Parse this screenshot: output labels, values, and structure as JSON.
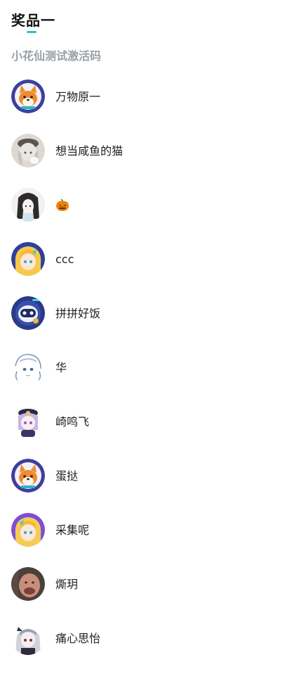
{
  "header": {
    "title": "奖品一",
    "subtitle": "小花仙测试激活码"
  },
  "winners": [
    {
      "name": "万物原一",
      "avatar": "shiba-dog-avatar"
    },
    {
      "name": "想当咸鱼的猫",
      "avatar": "anime-girl-hat-avatar"
    },
    {
      "name": "🎃",
      "avatar": "anime-dark-hair-avatar"
    },
    {
      "name": "ccc",
      "avatar": "anime-blonde-girl-avatar"
    },
    {
      "name": "拼拼好饭",
      "avatar": "robot-avatar"
    },
    {
      "name": "华",
      "avatar": "sketch-girl-avatar"
    },
    {
      "name": "崎鸣飞",
      "avatar": "anime-purple-hair-avatar"
    },
    {
      "name": "蛋挞",
      "avatar": "shiba-dog-avatar"
    },
    {
      "name": "采集呢",
      "avatar": "anime-blonde-girl-purple-avatar"
    },
    {
      "name": "燍玥",
      "avatar": "photo-face-avatar"
    },
    {
      "name": "痛心思怡",
      "avatar": "anime-silver-hair-avatar"
    }
  ],
  "colors": {
    "accent": "#1cc8d0",
    "subtitle": "#9aa0a6"
  }
}
